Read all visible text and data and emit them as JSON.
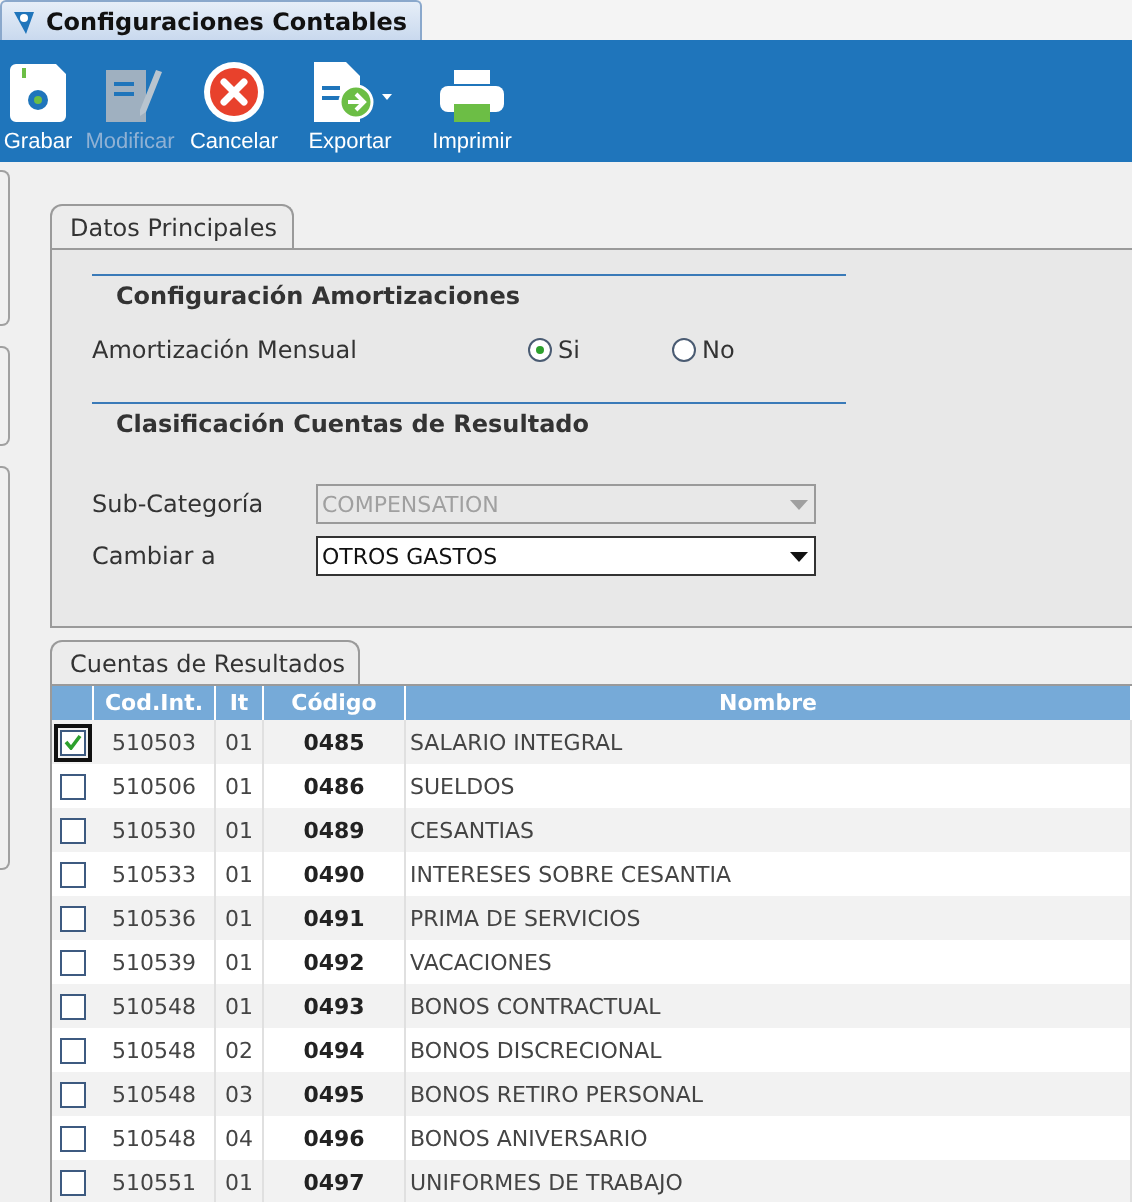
{
  "window": {
    "title": "Configuraciones Contables"
  },
  "toolbar": [
    {
      "label": "Grabar",
      "kind": "save",
      "disabled": false
    },
    {
      "label": "Modificar",
      "kind": "edit",
      "disabled": true
    },
    {
      "label": "Cancelar",
      "kind": "cancel",
      "disabled": false
    },
    {
      "label": "Exportar",
      "kind": "export",
      "disabled": false
    },
    {
      "label": "Imprimir",
      "kind": "print",
      "disabled": false
    }
  ],
  "main_tab": {
    "label": "Datos Principales"
  },
  "amortization": {
    "heading": "Configuración Amortizaciones",
    "label": "Amortización Mensual",
    "options": [
      {
        "label": "Si",
        "selected": true
      },
      {
        "label": "No",
        "selected": false
      }
    ]
  },
  "classification": {
    "heading": "Clasificación Cuentas de Resultado",
    "fields": [
      {
        "label": "Sub-Categoría",
        "value": "COMPENSATION",
        "disabled": true
      },
      {
        "label": "Cambiar a",
        "value": "OTROS GASTOS",
        "disabled": false
      }
    ]
  },
  "results_tab": {
    "label": "Cuentas de Resultados"
  },
  "table": {
    "columns": [
      "Cod.Int.",
      "It",
      "Código",
      "Nombre"
    ],
    "rows": [
      {
        "checked": true,
        "cells": [
          "510503",
          "01",
          "0485",
          "SALARIO INTEGRAL"
        ]
      },
      {
        "checked": false,
        "cells": [
          "510506",
          "01",
          "0486",
          "SUELDOS"
        ]
      },
      {
        "checked": false,
        "cells": [
          "510530",
          "01",
          "0489",
          "CESANTIAS"
        ]
      },
      {
        "checked": false,
        "cells": [
          "510533",
          "01",
          "0490",
          "INTERESES SOBRE CESANTIA"
        ]
      },
      {
        "checked": false,
        "cells": [
          "510536",
          "01",
          "0491",
          "PRIMA DE SERVICIOS"
        ]
      },
      {
        "checked": false,
        "cells": [
          "510539",
          "01",
          "0492",
          "VACACIONES"
        ]
      },
      {
        "checked": false,
        "cells": [
          "510548",
          "01",
          "0493",
          "BONOS CONTRACTUAL"
        ]
      },
      {
        "checked": false,
        "cells": [
          "510548",
          "02",
          "0494",
          "BONOS DISCRECIONAL"
        ]
      },
      {
        "checked": false,
        "cells": [
          "510548",
          "03",
          "0495",
          "BONOS RETIRO PERSONAL"
        ]
      },
      {
        "checked": false,
        "cells": [
          "510548",
          "04",
          "0496",
          "BONOS ANIVERSARIO"
        ]
      },
      {
        "checked": false,
        "cells": [
          "510551",
          "01",
          "0497",
          "UNIFORMES DE TRABAJO"
        ]
      }
    ]
  }
}
